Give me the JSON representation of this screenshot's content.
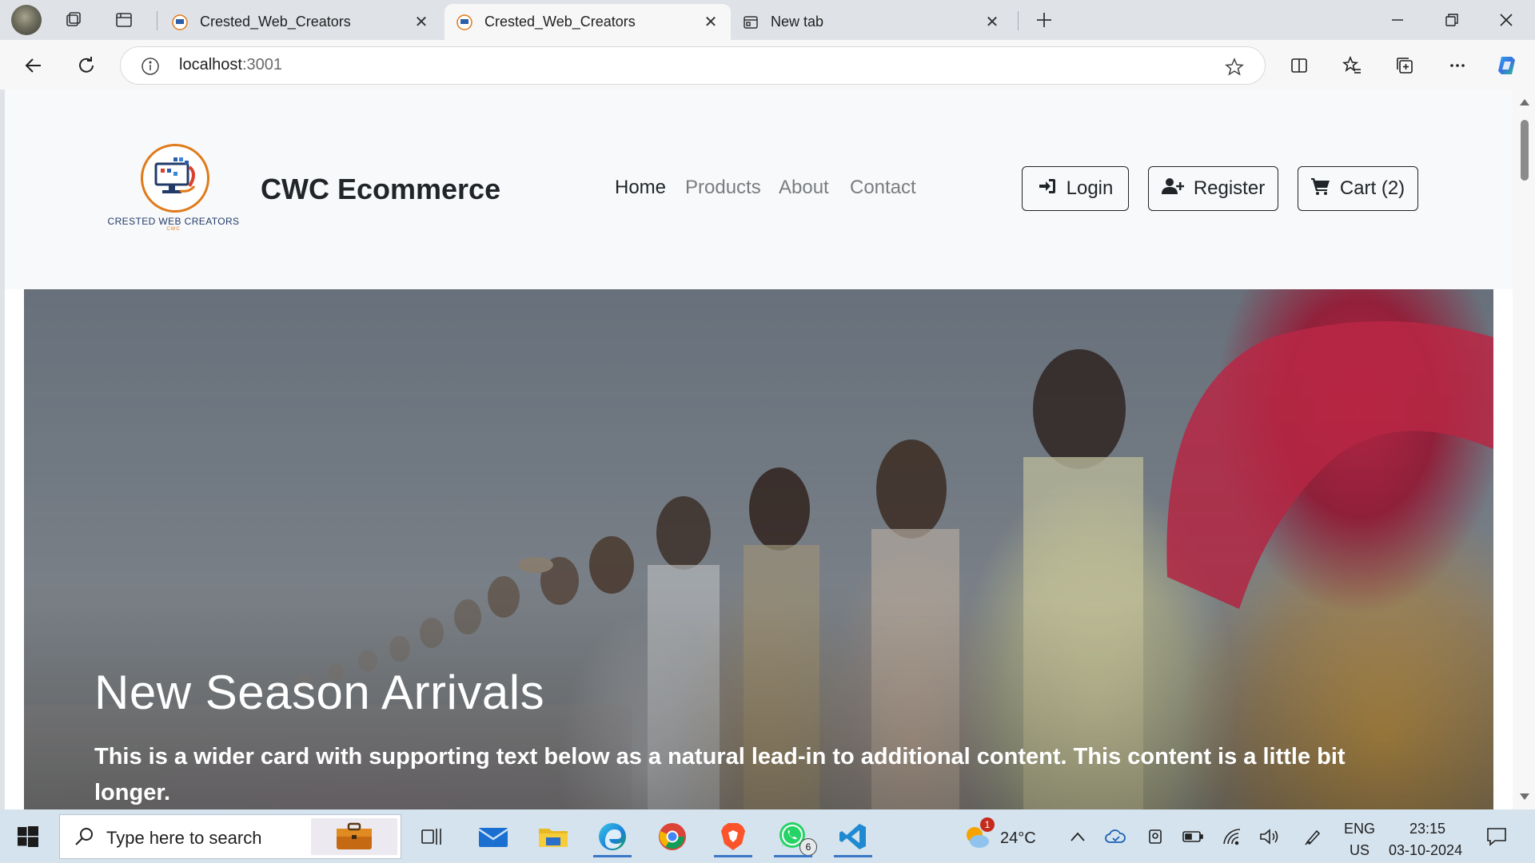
{
  "browser": {
    "tabs": [
      {
        "title": "Crested_Web_Creators",
        "active": false
      },
      {
        "title": "Crested_Web_Creators",
        "active": true
      },
      {
        "title": "New tab",
        "active": false
      }
    ],
    "address": {
      "host": "localhost",
      "port": ":3001"
    }
  },
  "site": {
    "logo_text": "CRESTED WEB CREATORS",
    "logo_sub": "CWC",
    "brand": "CWC Ecommerce",
    "nav": [
      "Home",
      "Products",
      "About",
      "Contact"
    ],
    "buttons": {
      "login": "Login",
      "register": "Register",
      "cart": "Cart (2)"
    }
  },
  "hero": {
    "title": "New Season Arrivals",
    "text": "This is a wider card with supporting text below as a natural lead-in to additional content. This content is a little bit longer."
  },
  "taskbar": {
    "search_placeholder": "Type here to search",
    "whatsapp_badge": "6",
    "weather_badge": "1",
    "weather": "24°C",
    "lang_top": "ENG",
    "lang_bottom": "US",
    "time": "23:15",
    "date": "03-10-2024",
    "icons": [
      "windows-start-icon",
      "search-icon",
      "task-view-icon",
      "mail-icon",
      "file-explorer-icon",
      "edge-icon",
      "chrome-icon",
      "brave-icon",
      "whatsapp-icon",
      "vscode-icon"
    ]
  },
  "colors": {
    "accent_orange": "#e07a1a",
    "brand_dark": "#212529",
    "taskbar": "#d5e3ee"
  }
}
